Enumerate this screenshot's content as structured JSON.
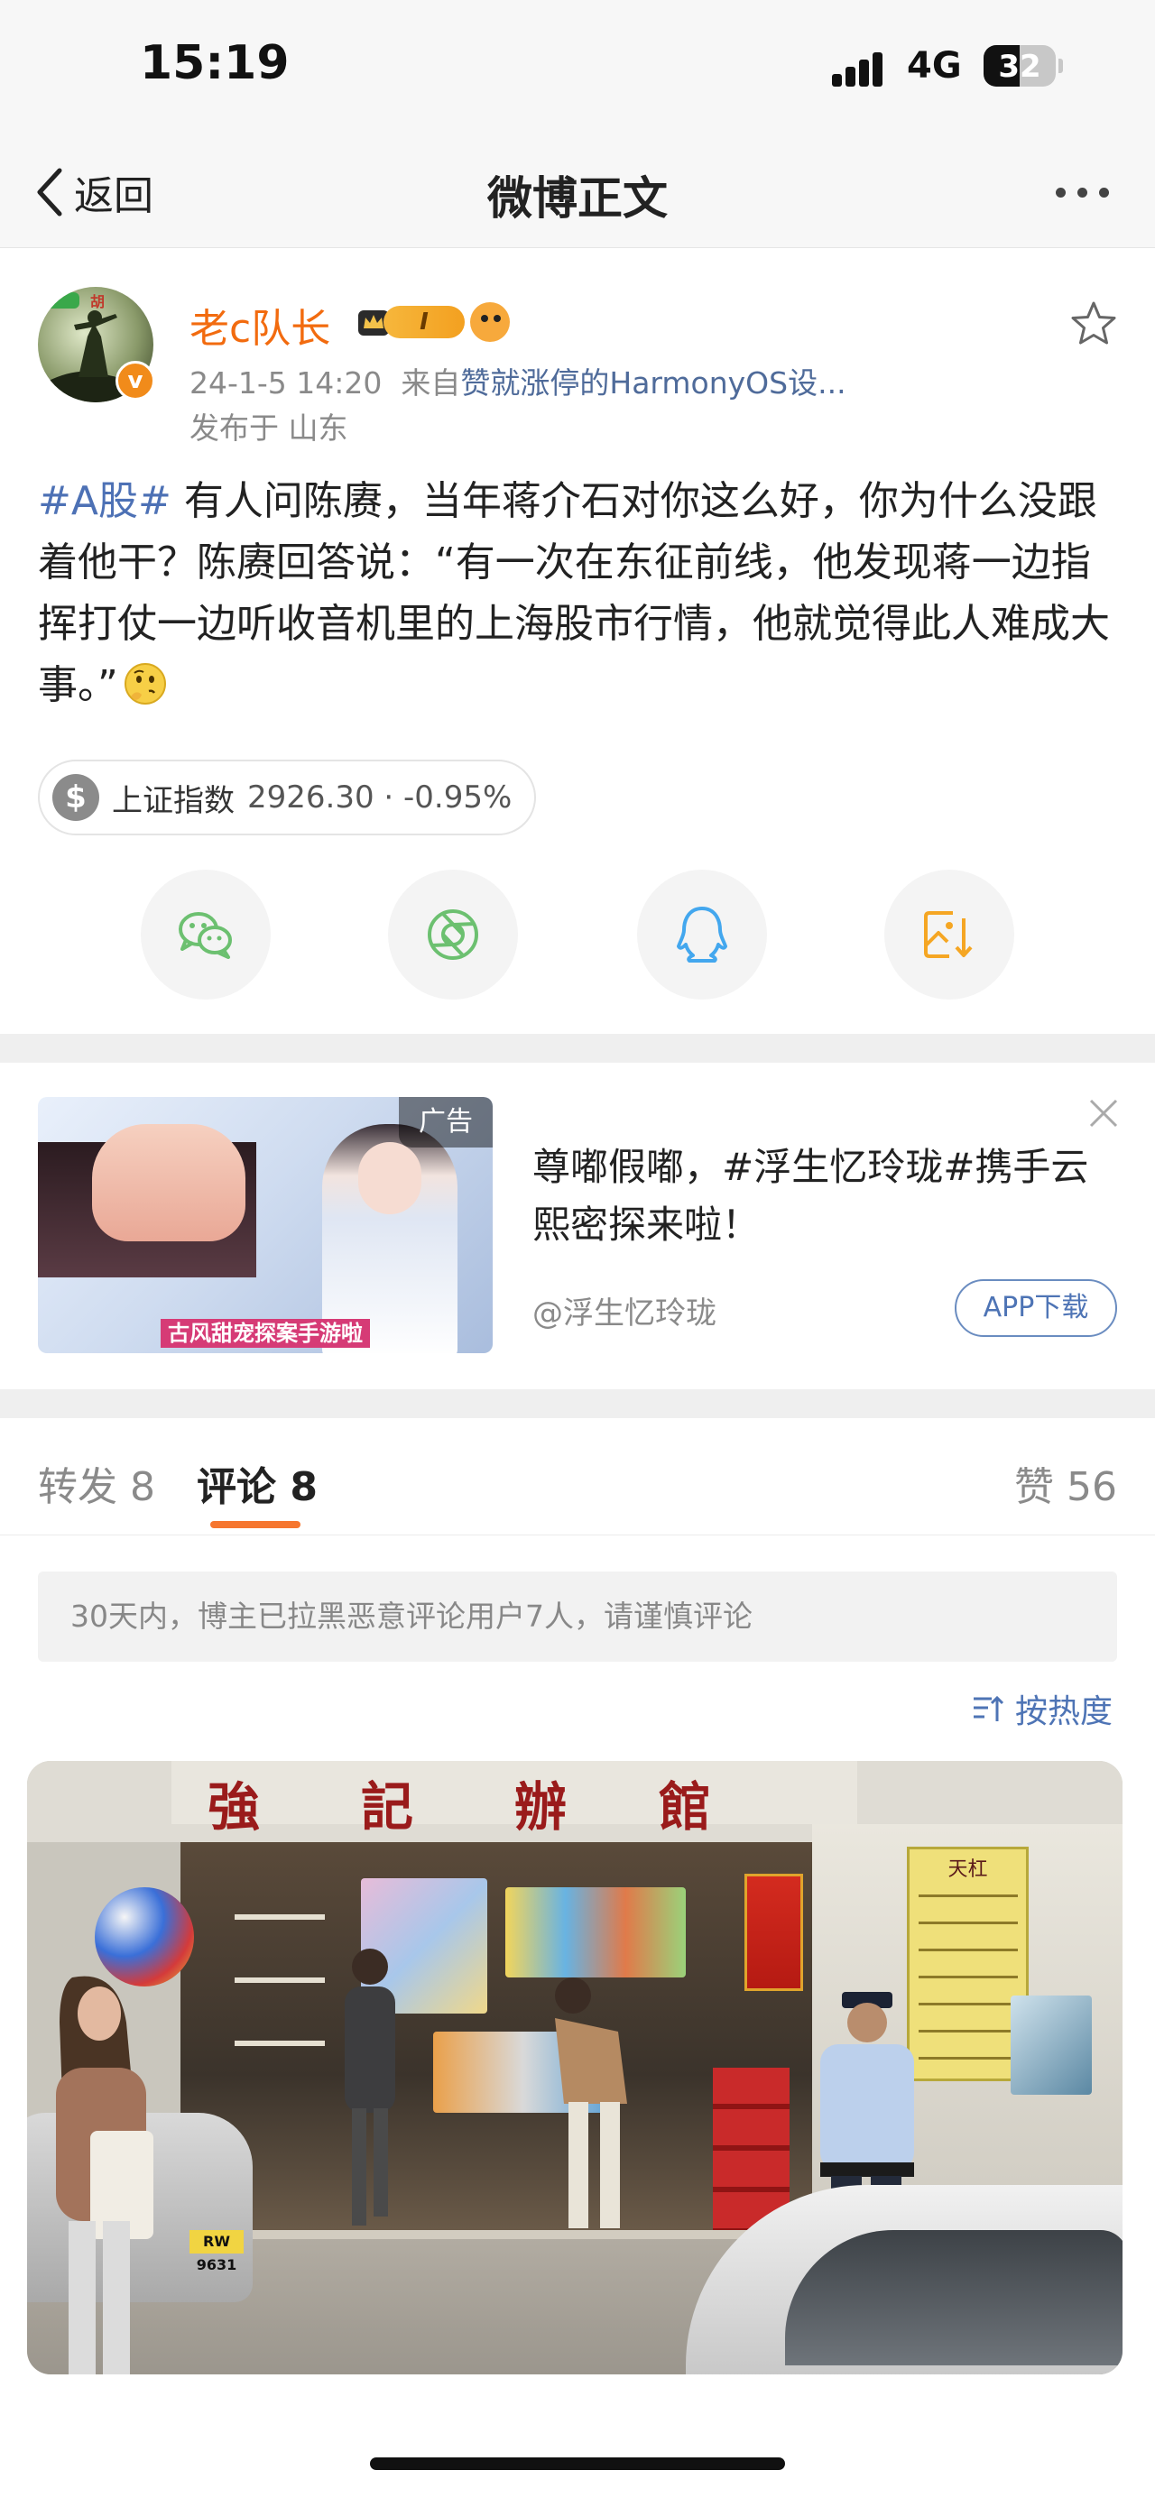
{
  "status_bar": {
    "time": "15:19",
    "network": "4G",
    "battery": "32"
  },
  "nav": {
    "back_label": "返回",
    "title": "微博正文"
  },
  "post": {
    "author": "老c队长",
    "level": "I",
    "verified_badge": "v",
    "timestamp": "24-1-5 14:20",
    "source_prefix": "来自",
    "source": "赞就涨停的HarmonyOS设...",
    "location": "发布于 山东",
    "topic": "#A股#",
    "text": " 有人问陈赓，当年蒋介石对你这么好，你为什么没跟着他干？陈赓回答说：“有一次在东征前线，他发现蒋一边指挥打仗一边听收音机里的上海股市行情，他就觉得此人难成大事。”",
    "emoji": "thinking-face"
  },
  "stock_chip": {
    "symbol": "$",
    "label": "上证指数",
    "value": "2926.30 · -0.95%"
  },
  "share": {
    "icons": [
      "wechat-icon",
      "moments-icon",
      "qq-icon",
      "save-image-icon"
    ],
    "colors": {
      "green": "#6cc070",
      "blue": "#43a7ee",
      "orange": "#f5a623"
    }
  },
  "ad": {
    "tag": "广告",
    "caption": "古风甜宠探案手游啦",
    "title": "尊嘟假嘟，#浮生忆玲珑#携手云熙密探来啦！",
    "account": "@浮生忆玲珑",
    "button": "APP下载"
  },
  "tabs": {
    "repost": "转发 8",
    "comments": "评论 8",
    "likes": "赞 56",
    "accent": "#f6762f"
  },
  "notice": "30天内，博主已拉黑恶意评论用户7人，请谨慎评论",
  "sort": {
    "label": "按热度"
  },
  "photo": {
    "sign_chars": [
      "強",
      "記",
      "辦",
      "館"
    ],
    "menu_title": "天杠",
    "plate": "RW 9631"
  }
}
